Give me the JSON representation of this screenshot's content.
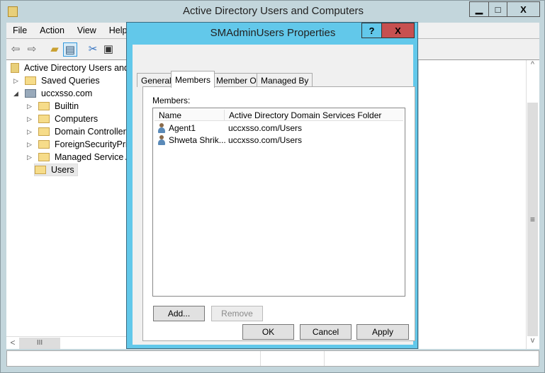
{
  "window": {
    "title": "Active Directory Users and Computers",
    "minimize": "▁",
    "maximize": "□",
    "close": "X"
  },
  "menu": [
    "File",
    "Action",
    "View",
    "Help"
  ],
  "tree": {
    "root": "Active Directory Users and Computers",
    "saved_queries": "Saved Queries",
    "domain": "uccxsso.com",
    "children": [
      "Builtin",
      "Computers",
      "Domain Controllers",
      "ForeignSecurityPrincipals",
      "Managed Service Accounts",
      "Users"
    ]
  },
  "scroll": {
    "up": "^",
    "down": "v",
    "left": "<",
    "thumb": "III",
    "mid": "≡"
  },
  "dialog": {
    "title": "SMAdminUsers Properties",
    "help": "?",
    "close": "X",
    "tabs": [
      "General",
      "Members",
      "Member Of",
      "Managed By"
    ],
    "members_label": "Members:",
    "columns": [
      "Name",
      "Active Directory Domain Services Folder"
    ],
    "rows": [
      {
        "name": "Agent1",
        "folder": "uccxsso.com/Users"
      },
      {
        "name": "Shweta Shrik...",
        "folder": "uccxsso.com/Users"
      }
    ],
    "add": "Add...",
    "remove": "Remove",
    "ok": "OK",
    "cancel": "Cancel",
    "apply": "Apply"
  }
}
